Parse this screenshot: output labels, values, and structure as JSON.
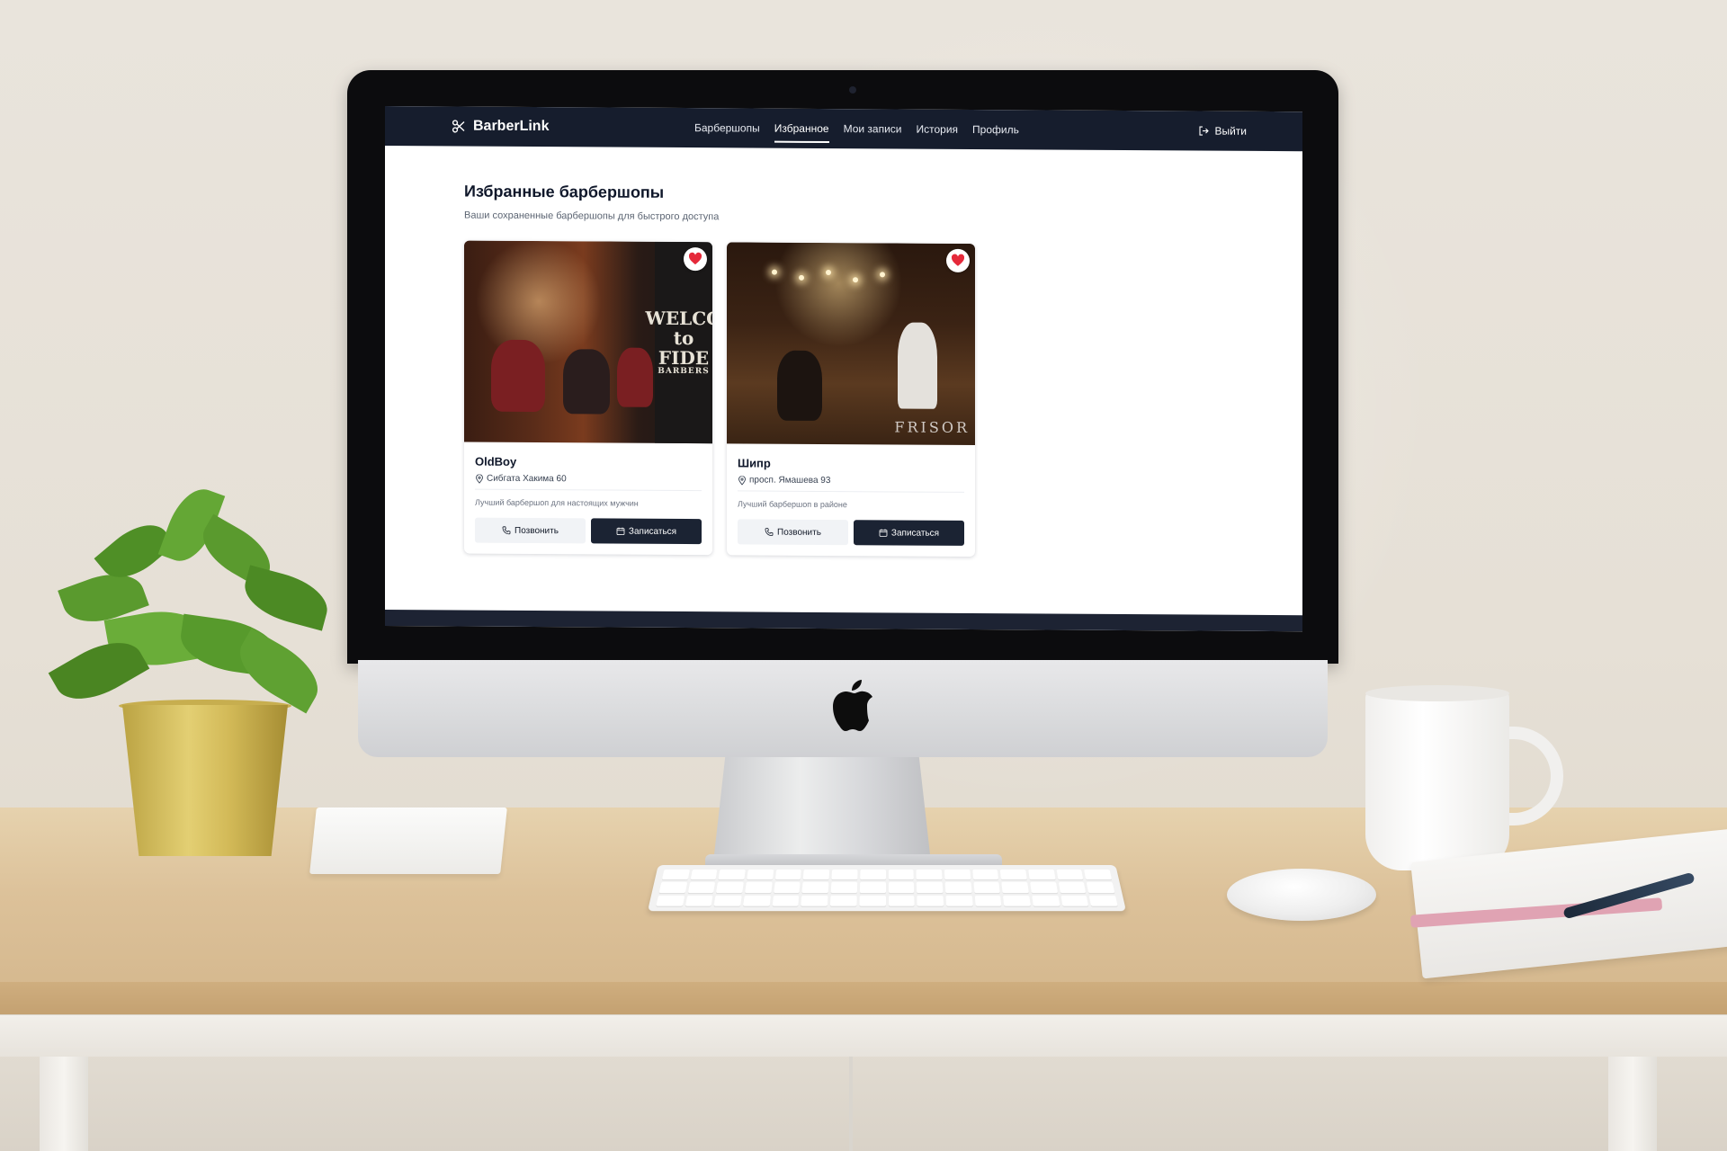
{
  "app": {
    "brand": "BarberLink"
  },
  "nav": {
    "links": [
      {
        "label": "Барбершопы"
      },
      {
        "label": "Избранное"
      },
      {
        "label": "Мои записи"
      },
      {
        "label": "История"
      },
      {
        "label": "Профиль"
      }
    ],
    "active": "Избранное",
    "logout_label": "Выйти"
  },
  "page": {
    "title": "Избранные барбершопы",
    "subtitle": "Ваши сохраненные барбершопы для быстрого доступа"
  },
  "favorites": [
    {
      "name": "OldBoy",
      "address": "Сибгата Хакима 60",
      "description": "Лучший барбершоп для настоящих мужчин",
      "call_label": "Позвонить",
      "book_label": "Записаться",
      "image_sign": [
        "WELCO",
        "to",
        "FIDE",
        "BARBERS"
      ]
    },
    {
      "name": "Шипр",
      "address": "просп. Ямашева 93",
      "description": "Лучший барбершоп в районе",
      "call_label": "Позвонить",
      "book_label": "Записаться",
      "image_watermark": "FRISOR"
    }
  ],
  "colors": {
    "navbar": "#161d2d",
    "primary_button": "#1b2333",
    "favorite_heart": "#e5293a"
  },
  "icons": {
    "brand": "scissors-icon",
    "logout": "logout-icon",
    "address": "map-pin-icon",
    "call": "phone-icon",
    "book": "calendar-icon",
    "favorite": "heart-icon"
  }
}
